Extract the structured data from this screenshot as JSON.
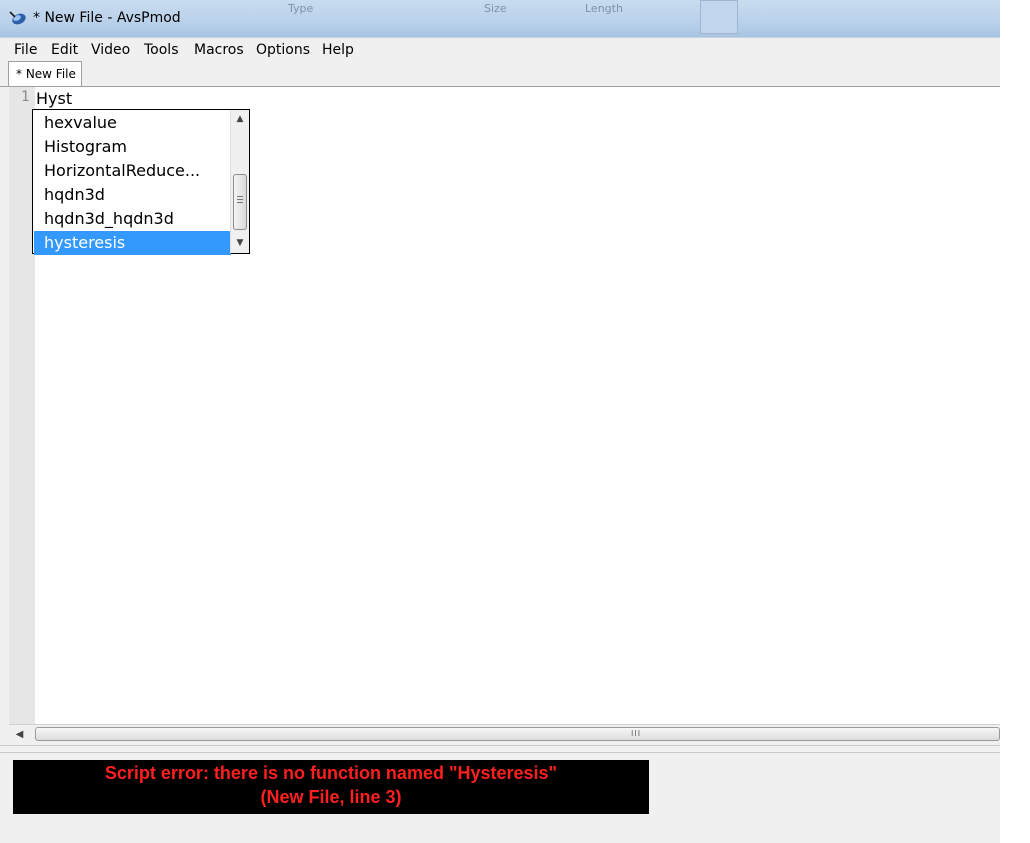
{
  "window": {
    "title": "* New File - AvsPmod",
    "background_ghost_text": [
      "Type",
      "Size",
      "Length"
    ],
    "app_icon": "avspmod-icon"
  },
  "menu": {
    "items": [
      "File",
      "Edit",
      "Video",
      "Tools",
      "Macros",
      "Options",
      "Help"
    ]
  },
  "tabs": [
    {
      "label": "* New File",
      "active": true
    }
  ],
  "editor": {
    "line_number": "1",
    "text": "Hyst"
  },
  "autocomplete": {
    "items": [
      "hexvalue",
      "Histogram",
      "HorizontalReduce...",
      "hqdn3d",
      "hqdn3d_hqdn3d",
      "hysteresis"
    ],
    "selected": "hysteresis",
    "scrollbar_icons": [
      "scroll-up-arrow-icon",
      "scroll-down-arrow-icon",
      "scroll-grip-icon"
    ]
  },
  "hscrollbar": {
    "grip": "III"
  },
  "error": {
    "line1": "Script error: there is no function named \"Hysteresis\"",
    "line2": "(New File, line 3)",
    "text_color": "#ff1f1f",
    "background": "#000000"
  },
  "colors": {
    "selection": "#3399ff",
    "gutter": "#e6e6e6",
    "chrome": "#f0f0f0"
  }
}
